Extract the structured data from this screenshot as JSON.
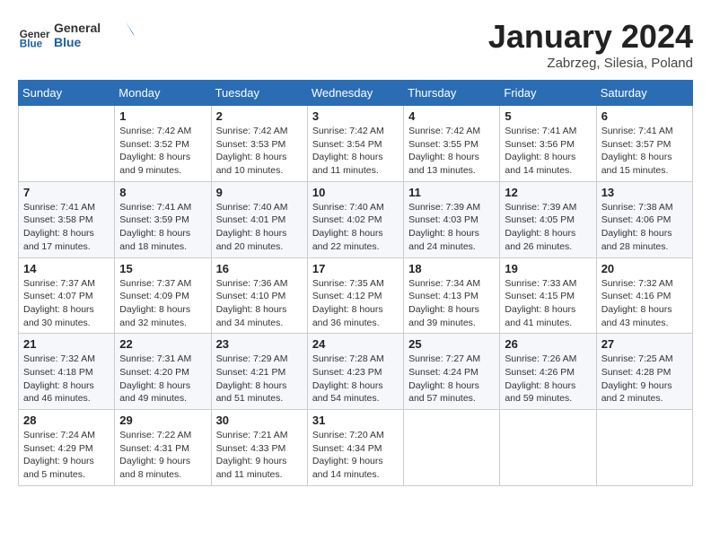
{
  "header": {
    "logo_general": "General",
    "logo_blue": "Blue",
    "month": "January 2024",
    "location": "Zabrzeg, Silesia, Poland"
  },
  "days_of_week": [
    "Sunday",
    "Monday",
    "Tuesday",
    "Wednesday",
    "Thursday",
    "Friday",
    "Saturday"
  ],
  "weeks": [
    [
      {
        "day": "",
        "info": ""
      },
      {
        "day": "1",
        "info": "Sunrise: 7:42 AM\nSunset: 3:52 PM\nDaylight: 8 hours\nand 9 minutes."
      },
      {
        "day": "2",
        "info": "Sunrise: 7:42 AM\nSunset: 3:53 PM\nDaylight: 8 hours\nand 10 minutes."
      },
      {
        "day": "3",
        "info": "Sunrise: 7:42 AM\nSunset: 3:54 PM\nDaylight: 8 hours\nand 11 minutes."
      },
      {
        "day": "4",
        "info": "Sunrise: 7:42 AM\nSunset: 3:55 PM\nDaylight: 8 hours\nand 13 minutes."
      },
      {
        "day": "5",
        "info": "Sunrise: 7:41 AM\nSunset: 3:56 PM\nDaylight: 8 hours\nand 14 minutes."
      },
      {
        "day": "6",
        "info": "Sunrise: 7:41 AM\nSunset: 3:57 PM\nDaylight: 8 hours\nand 15 minutes."
      }
    ],
    [
      {
        "day": "7",
        "info": "Sunrise: 7:41 AM\nSunset: 3:58 PM\nDaylight: 8 hours\nand 17 minutes."
      },
      {
        "day": "8",
        "info": "Sunrise: 7:41 AM\nSunset: 3:59 PM\nDaylight: 8 hours\nand 18 minutes."
      },
      {
        "day": "9",
        "info": "Sunrise: 7:40 AM\nSunset: 4:01 PM\nDaylight: 8 hours\nand 20 minutes."
      },
      {
        "day": "10",
        "info": "Sunrise: 7:40 AM\nSunset: 4:02 PM\nDaylight: 8 hours\nand 22 minutes."
      },
      {
        "day": "11",
        "info": "Sunrise: 7:39 AM\nSunset: 4:03 PM\nDaylight: 8 hours\nand 24 minutes."
      },
      {
        "day": "12",
        "info": "Sunrise: 7:39 AM\nSunset: 4:05 PM\nDaylight: 8 hours\nand 26 minutes."
      },
      {
        "day": "13",
        "info": "Sunrise: 7:38 AM\nSunset: 4:06 PM\nDaylight: 8 hours\nand 28 minutes."
      }
    ],
    [
      {
        "day": "14",
        "info": "Sunrise: 7:37 AM\nSunset: 4:07 PM\nDaylight: 8 hours\nand 30 minutes."
      },
      {
        "day": "15",
        "info": "Sunrise: 7:37 AM\nSunset: 4:09 PM\nDaylight: 8 hours\nand 32 minutes."
      },
      {
        "day": "16",
        "info": "Sunrise: 7:36 AM\nSunset: 4:10 PM\nDaylight: 8 hours\nand 34 minutes."
      },
      {
        "day": "17",
        "info": "Sunrise: 7:35 AM\nSunset: 4:12 PM\nDaylight: 8 hours\nand 36 minutes."
      },
      {
        "day": "18",
        "info": "Sunrise: 7:34 AM\nSunset: 4:13 PM\nDaylight: 8 hours\nand 39 minutes."
      },
      {
        "day": "19",
        "info": "Sunrise: 7:33 AM\nSunset: 4:15 PM\nDaylight: 8 hours\nand 41 minutes."
      },
      {
        "day": "20",
        "info": "Sunrise: 7:32 AM\nSunset: 4:16 PM\nDaylight: 8 hours\nand 43 minutes."
      }
    ],
    [
      {
        "day": "21",
        "info": "Sunrise: 7:32 AM\nSunset: 4:18 PM\nDaylight: 8 hours\nand 46 minutes."
      },
      {
        "day": "22",
        "info": "Sunrise: 7:31 AM\nSunset: 4:20 PM\nDaylight: 8 hours\nand 49 minutes."
      },
      {
        "day": "23",
        "info": "Sunrise: 7:29 AM\nSunset: 4:21 PM\nDaylight: 8 hours\nand 51 minutes."
      },
      {
        "day": "24",
        "info": "Sunrise: 7:28 AM\nSunset: 4:23 PM\nDaylight: 8 hours\nand 54 minutes."
      },
      {
        "day": "25",
        "info": "Sunrise: 7:27 AM\nSunset: 4:24 PM\nDaylight: 8 hours\nand 57 minutes."
      },
      {
        "day": "26",
        "info": "Sunrise: 7:26 AM\nSunset: 4:26 PM\nDaylight: 8 hours\nand 59 minutes."
      },
      {
        "day": "27",
        "info": "Sunrise: 7:25 AM\nSunset: 4:28 PM\nDaylight: 9 hours\nand 2 minutes."
      }
    ],
    [
      {
        "day": "28",
        "info": "Sunrise: 7:24 AM\nSunset: 4:29 PM\nDaylight: 9 hours\nand 5 minutes."
      },
      {
        "day": "29",
        "info": "Sunrise: 7:22 AM\nSunset: 4:31 PM\nDaylight: 9 hours\nand 8 minutes."
      },
      {
        "day": "30",
        "info": "Sunrise: 7:21 AM\nSunset: 4:33 PM\nDaylight: 9 hours\nand 11 minutes."
      },
      {
        "day": "31",
        "info": "Sunrise: 7:20 AM\nSunset: 4:34 PM\nDaylight: 9 hours\nand 14 minutes."
      },
      {
        "day": "",
        "info": ""
      },
      {
        "day": "",
        "info": ""
      },
      {
        "day": "",
        "info": ""
      }
    ]
  ]
}
